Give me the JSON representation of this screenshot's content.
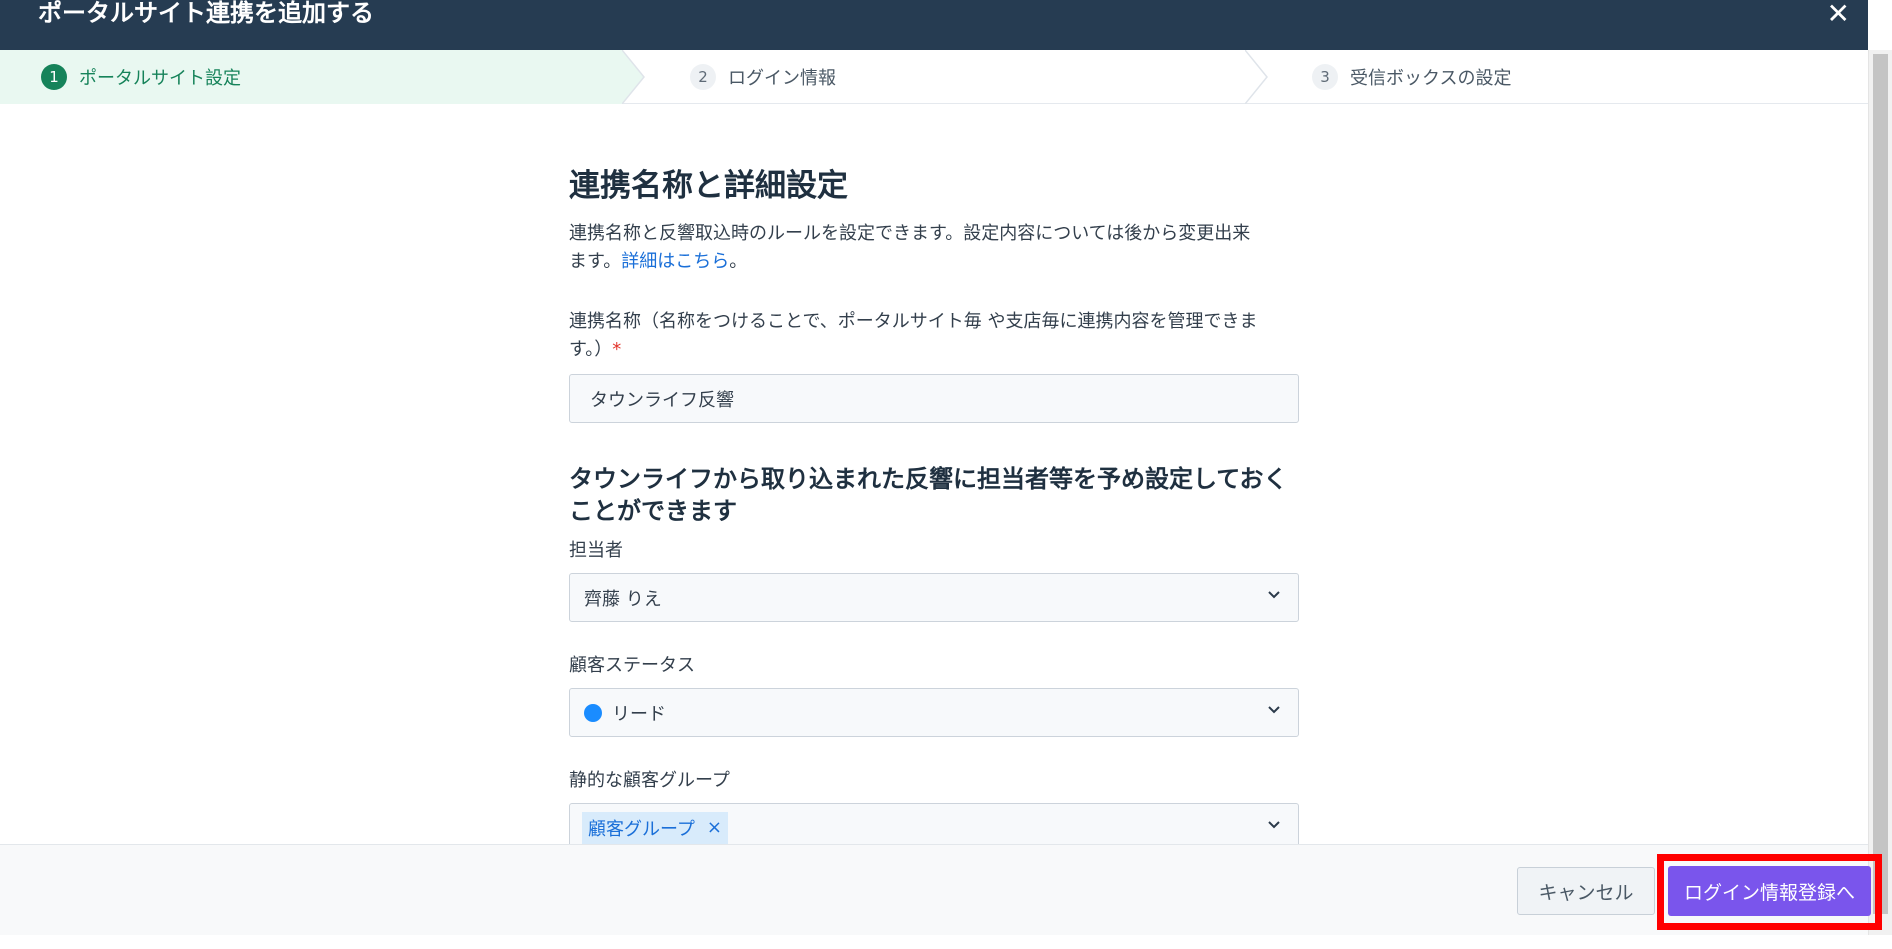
{
  "header": {
    "title": "ポータルサイト連携を追加する",
    "close_icon": "close-icon"
  },
  "steps": [
    {
      "num": "1",
      "label": "ポータルサイト設定",
      "active": true
    },
    {
      "num": "2",
      "label": "ログイン情報",
      "active": false
    },
    {
      "num": "3",
      "label": "受信ボックスの設定",
      "active": false
    }
  ],
  "section": {
    "heading": "連携名称と詳細設定",
    "desc_line1": "連携名称と反響取込時のルールを設定できます。設定内容については後から変更出来",
    "desc_line2_prefix": "ます。",
    "desc_link": "詳細はこちら",
    "desc_line2_suffix": "。"
  },
  "name_field": {
    "label_line1": "連携名称（名称をつけることで、ポータルサイト毎 や支店毎に連携内容を管理できま",
    "label_line2": "す。）",
    "required_mark": "*",
    "value": "タウンライフ反響"
  },
  "defaults": {
    "heading_line1": "タウンライフから取り込まれた反響に担当者等を予め設定しておく",
    "heading_line2": "ことができます",
    "assignee_label": "担当者",
    "assignee_value": "齊藤 りえ",
    "status_label": "顧客ステータス",
    "status_value": "リード",
    "status_color": "#1a8cff",
    "group_label": "静的な顧客グループ",
    "group_tag": "顧客グループ",
    "group_tag_remove": "×"
  },
  "footer": {
    "cancel_label": "キャンセル",
    "next_label": "ログイン情報登録へ"
  },
  "colors": {
    "header_bg": "#263c52",
    "active_step": "#16835a",
    "primary": "#7a55ec",
    "highlight": "#ff0000"
  }
}
